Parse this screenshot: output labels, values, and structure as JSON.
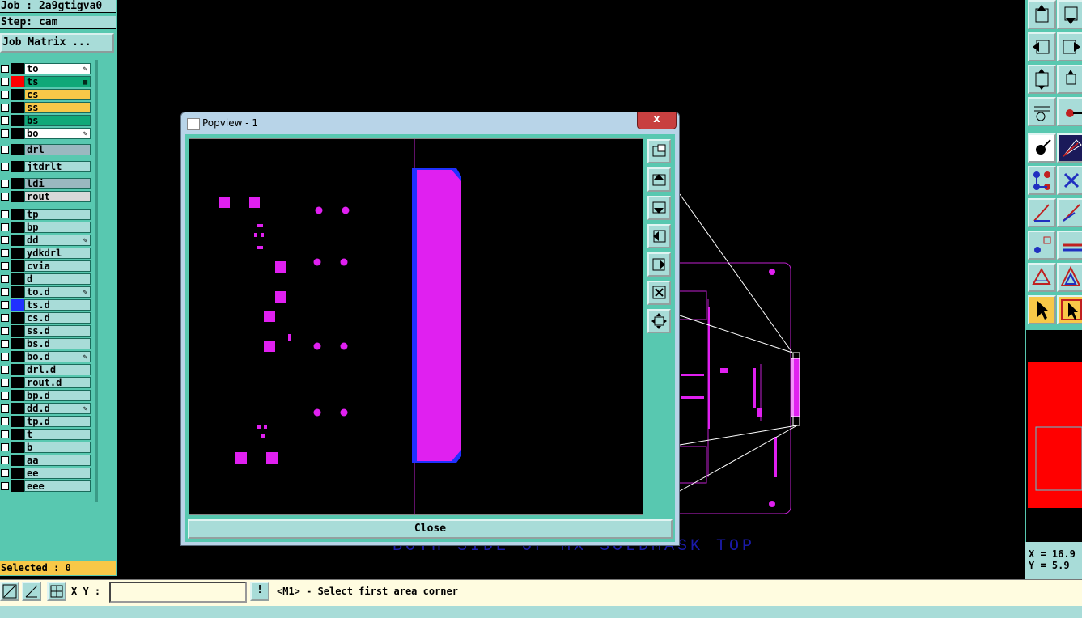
{
  "job": {
    "line1": "Job : 2a9gtigva0",
    "line2": "Step: cam"
  },
  "job_matrix_button": "Job Matrix ...",
  "layers": [
    {
      "name": "to",
      "bg": "#ffffff",
      "swatch": "#000000",
      "mark": "edit"
    },
    {
      "name": "ts",
      "bg": "#10a878",
      "swatch": "#ff0000",
      "mark": "grid"
    },
    {
      "name": "cs",
      "bg": "#f8c848",
      "swatch": "#000000",
      "mark": ""
    },
    {
      "name": "ss",
      "bg": "#f8c848",
      "swatch": "#000000",
      "mark": ""
    },
    {
      "name": "bs",
      "bg": "#10a878",
      "swatch": "#000000",
      "mark": ""
    },
    {
      "name": "bo",
      "bg": "#ffffff",
      "swatch": "#000000",
      "mark": "edit"
    },
    {
      "name": "drl",
      "bg": "#9ab8c0",
      "swatch": "#000000",
      "mark": ""
    },
    {
      "name": "jtdrlt",
      "bg": "#a8dcd8",
      "swatch": "#000000",
      "mark": ""
    },
    {
      "name": "ldi",
      "bg": "#9ab8c0",
      "swatch": "#000000",
      "mark": ""
    },
    {
      "name": "rout",
      "bg": "#d8d8d8",
      "swatch": "#000000",
      "mark": ""
    },
    {
      "name": "tp",
      "bg": "#a8dcd8",
      "swatch": "#000000",
      "mark": ""
    },
    {
      "name": "bp",
      "bg": "#a8dcd8",
      "swatch": "#000000",
      "mark": ""
    },
    {
      "name": "dd",
      "bg": "#a8dcd8",
      "swatch": "#000000",
      "mark": "edit"
    },
    {
      "name": "ydkdrl",
      "bg": "#a8dcd8",
      "swatch": "#000000",
      "mark": ""
    },
    {
      "name": "cvia",
      "bg": "#a8dcd8",
      "swatch": "#000000",
      "mark": ""
    },
    {
      "name": "d",
      "bg": "#a8dcd8",
      "swatch": "#000000",
      "mark": ""
    },
    {
      "name": "to.d",
      "bg": "#a8dcd8",
      "swatch": "#000000",
      "mark": "edit"
    },
    {
      "name": "ts.d",
      "bg": "#a8dcd8",
      "swatch": "#2030ff",
      "mark": ""
    },
    {
      "name": "cs.d",
      "bg": "#a8dcd8",
      "swatch": "#000000",
      "mark": ""
    },
    {
      "name": "ss.d",
      "bg": "#a8dcd8",
      "swatch": "#000000",
      "mark": ""
    },
    {
      "name": "bs.d",
      "bg": "#a8dcd8",
      "swatch": "#000000",
      "mark": ""
    },
    {
      "name": "bo.d",
      "bg": "#a8dcd8",
      "swatch": "#000000",
      "mark": "edit"
    },
    {
      "name": "drl.d",
      "bg": "#a8dcd8",
      "swatch": "#000000",
      "mark": ""
    },
    {
      "name": "rout.d",
      "bg": "#a8dcd8",
      "swatch": "#000000",
      "mark": ""
    },
    {
      "name": "bp.d",
      "bg": "#a8dcd8",
      "swatch": "#000000",
      "mark": ""
    },
    {
      "name": "dd.d",
      "bg": "#a8dcd8",
      "swatch": "#000000",
      "mark": "edit"
    },
    {
      "name": "tp.d",
      "bg": "#a8dcd8",
      "swatch": "#000000",
      "mark": ""
    },
    {
      "name": "t",
      "bg": "#a8dcd8",
      "swatch": "#000000",
      "mark": ""
    },
    {
      "name": "b",
      "bg": "#a8dcd8",
      "swatch": "#000000",
      "mark": ""
    },
    {
      "name": "aa",
      "bg": "#a8dcd8",
      "swatch": "#000000",
      "mark": ""
    },
    {
      "name": "ee",
      "bg": "#a8dcd8",
      "swatch": "#000000",
      "mark": ""
    },
    {
      "name": "eee",
      "bg": "#a8dcd8",
      "swatch": "#000000",
      "mark": ""
    }
  ],
  "selected": "Selected : 0",
  "bottom": {
    "xy_label": "X Y :",
    "xy_value": "",
    "info_icon": "!",
    "status": "<M1> - Select first area corner"
  },
  "popview": {
    "title": "Popview - 1",
    "close_x": "x",
    "close_button": "Close"
  },
  "coords": {
    "x": "X = 16.9",
    "y": "Y = 5.9"
  },
  "watermark": "BOTH SIDE OF MX SOLDMASK TOP",
  "colors": {
    "panel": "#58c8b0",
    "button": "#a8dcd8",
    "pad": "#e020f0",
    "accent": "#2030ff"
  }
}
